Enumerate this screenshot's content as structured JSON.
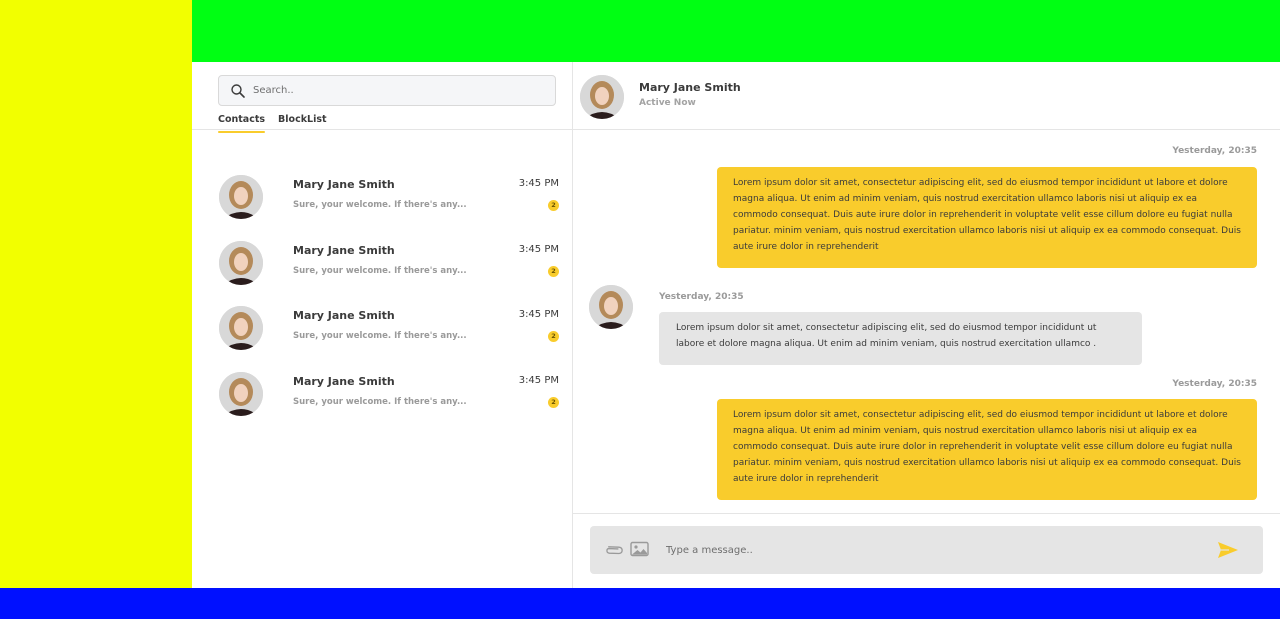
{
  "colors": {
    "accent": "#f9cc2c",
    "incoming_bubble": "#e5e5e5",
    "region_left": "#f2ff00",
    "region_top": "#00ff13",
    "region_bottom": "#0010ff"
  },
  "search": {
    "placeholder": "Search.."
  },
  "tabs": [
    {
      "label": "Contacts",
      "active": true
    },
    {
      "label": "BlockList",
      "active": false
    }
  ],
  "contacts": [
    {
      "name": "Mary Jane Smith",
      "preview": "Sure, your welcome. If there's any...",
      "time": "3:45 PM",
      "badge": "2"
    },
    {
      "name": "Mary Jane Smith",
      "preview": "Sure, your welcome. If there's any...",
      "time": "3:45 PM",
      "badge": "2"
    },
    {
      "name": "Mary Jane Smith",
      "preview": "Sure, your welcome. If there's any...",
      "time": "3:45 PM",
      "badge": "2"
    },
    {
      "name": "Mary Jane Smith",
      "preview": "Sure, your welcome. If there's any...",
      "time": "3:45 PM",
      "badge": "2"
    }
  ],
  "chat_header": {
    "name": "Mary Jane Smith",
    "status": "Active Now"
  },
  "messages": [
    {
      "direction": "outgoing",
      "time": "Yesterday, 20:35",
      "text": "Lorem ipsum dolor sit amet, consectetur adipiscing elit, sed do eiusmod tempor incididunt ut labore et dolore magna aliqua. Ut enim ad minim veniam, quis nostrud exercitation ullamco laboris nisi ut aliquip ex ea commodo consequat. Duis aute irure dolor in reprehenderit in voluptate velit esse cillum dolore eu fugiat nulla pariatur. minim veniam, quis nostrud exercitation ullamco laboris nisi ut aliquip ex ea commodo consequat. Duis aute irure dolor in reprehenderit"
    },
    {
      "direction": "incoming",
      "time": "Yesterday, 20:35",
      "text": "Lorem ipsum dolor sit amet, consectetur adipiscing elit, sed do eiusmod tempor incididunt ut labore et dolore magna aliqua. Ut enim ad minim veniam, quis nostrud exercitation ullamco ."
    },
    {
      "direction": "outgoing",
      "time": "Yesterday, 20:35",
      "text": "Lorem ipsum dolor sit amet, consectetur adipiscing elit, sed do eiusmod tempor incididunt ut labore et dolore magna aliqua. Ut enim ad minim veniam, quis nostrud exercitation ullamco laboris nisi ut aliquip ex ea commodo consequat. Duis aute irure dolor in reprehenderit in voluptate velit esse cillum dolore eu fugiat nulla pariatur. minim veniam, quis nostrud exercitation ullamco laboris nisi ut aliquip ex ea commodo consequat. Duis aute irure dolor in reprehenderit"
    }
  ],
  "composer": {
    "placeholder": "Type a message.."
  },
  "icons": {
    "search": "search-icon",
    "attach": "paperclip-icon",
    "image": "image-icon",
    "send": "send-icon",
    "avatar": "avatar-photo"
  }
}
